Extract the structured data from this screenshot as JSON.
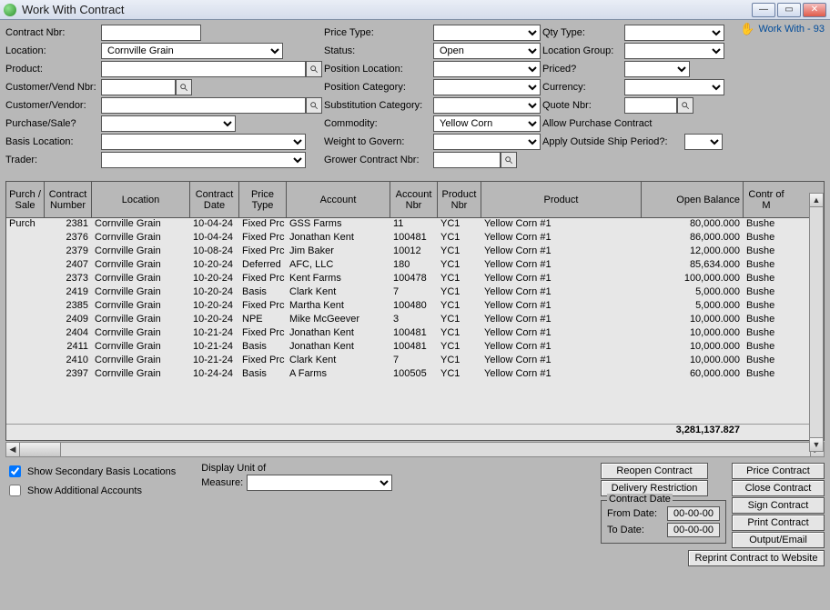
{
  "window": {
    "title": "Work With Contract"
  },
  "status": {
    "text": "Work With  - 93"
  },
  "form": {
    "col1": {
      "contract_nbr": {
        "label": "Contract Nbr:"
      },
      "location": {
        "label": "Location:",
        "value": "Cornville Grain"
      },
      "product": {
        "label": "Product:"
      },
      "cust_vend_nbr": {
        "label": "Customer/Vend Nbr:"
      },
      "cust_vendor": {
        "label": "Customer/Vendor:"
      },
      "purchase_sale": {
        "label": "Purchase/Sale?"
      },
      "basis_location": {
        "label": "Basis Location:"
      },
      "trader": {
        "label": "Trader:"
      }
    },
    "col2": {
      "price_type": {
        "label": "Price Type:"
      },
      "status": {
        "label": "Status:",
        "value": "Open"
      },
      "position_location": {
        "label": "Position Location:"
      },
      "position_category": {
        "label": "Position Category:"
      },
      "substitution_category": {
        "label": "Substitution Category:"
      },
      "commodity": {
        "label": "Commodity:",
        "value": "Yellow Corn"
      },
      "weight_govern": {
        "label": "Weight to Govern:"
      },
      "grower_contract_nbr": {
        "label": "Grower Contract Nbr:"
      }
    },
    "col3": {
      "qty_type": {
        "label": "Qty Type:"
      },
      "location_group": {
        "label": "Location Group:"
      },
      "priced": {
        "label": "Priced?"
      },
      "currency": {
        "label": "Currency:"
      },
      "quote_nbr": {
        "label": "Quote Nbr:"
      },
      "allow_purchase": {
        "label": "Allow Purchase Contract"
      },
      "apply_outside": {
        "label": "Apply Outside Ship Period?:"
      }
    }
  },
  "grid": {
    "headers": {
      "purch_sale": "Purch / Sale",
      "contract_number": "Contract Number",
      "location": "Location",
      "contract_date": "Contract Date",
      "price_type": "Price Type",
      "account": "Account",
      "account_nbr": "Account Nbr",
      "product_nbr": "Product Nbr",
      "product": "Product",
      "open_balance": "Open Balance",
      "unit_measure": "Contr of M"
    },
    "rows": [
      {
        "ps": "Purch",
        "cn": "2381",
        "loc": "Cornville Grain",
        "cd": "10-04-24",
        "pt": "Fixed Prc",
        "acc": "GSS Farms",
        "an": "11",
        "pn": "YC1",
        "prod": "Yellow Corn #1",
        "ob": "80,000.000",
        "um": "Bushe"
      },
      {
        "ps": "",
        "cn": "2376",
        "loc": "Cornville Grain",
        "cd": "10-04-24",
        "pt": "Fixed Prc",
        "acc": "Jonathan Kent",
        "an": "100481",
        "pn": "YC1",
        "prod": "Yellow Corn #1",
        "ob": "86,000.000",
        "um": "Bushe"
      },
      {
        "ps": "",
        "cn": "2379",
        "loc": "Cornville Grain",
        "cd": "10-08-24",
        "pt": "Fixed Prc",
        "acc": "Jim Baker",
        "an": "10012",
        "pn": "YC1",
        "prod": "Yellow Corn #1",
        "ob": "12,000.000",
        "um": "Bushe"
      },
      {
        "ps": "",
        "cn": "2407",
        "loc": "Cornville Grain",
        "cd": "10-20-24",
        "pt": "Deferred",
        "acc": "AFC, LLC",
        "an": "180",
        "pn": "YC1",
        "prod": "Yellow Corn #1",
        "ob": "85,634.000",
        "um": "Bushe"
      },
      {
        "ps": "",
        "cn": "2373",
        "loc": "Cornville Grain",
        "cd": "10-20-24",
        "pt": "Fixed Prc",
        "acc": "Kent Farms",
        "an": "100478",
        "pn": "YC1",
        "prod": "Yellow Corn #1",
        "ob": "100,000.000",
        "um": "Bushe"
      },
      {
        "ps": "",
        "cn": "2419",
        "loc": "Cornville Grain",
        "cd": "10-20-24",
        "pt": "Basis",
        "acc": "Clark Kent",
        "an": "7",
        "pn": "YC1",
        "prod": "Yellow Corn #1",
        "ob": "5,000.000",
        "um": "Bushe"
      },
      {
        "ps": "",
        "cn": "2385",
        "loc": "Cornville Grain",
        "cd": "10-20-24",
        "pt": "Fixed Prc",
        "acc": "Martha Kent",
        "an": "100480",
        "pn": "YC1",
        "prod": "Yellow Corn #1",
        "ob": "5,000.000",
        "um": "Bushe"
      },
      {
        "ps": "",
        "cn": "2409",
        "loc": "Cornville Grain",
        "cd": "10-20-24",
        "pt": "NPE",
        "acc": "Mike McGeever",
        "an": "3",
        "pn": "YC1",
        "prod": "Yellow Corn #1",
        "ob": "10,000.000",
        "um": "Bushe"
      },
      {
        "ps": "",
        "cn": "2404",
        "loc": "Cornville Grain",
        "cd": "10-21-24",
        "pt": "Fixed Prc",
        "acc": "Jonathan Kent",
        "an": "100481",
        "pn": "YC1",
        "prod": "Yellow Corn #1",
        "ob": "10,000.000",
        "um": "Bushe"
      },
      {
        "ps": "",
        "cn": "2411",
        "loc": "Cornville Grain",
        "cd": "10-21-24",
        "pt": "Basis",
        "acc": "Jonathan Kent",
        "an": "100481",
        "pn": "YC1",
        "prod": "Yellow Corn #1",
        "ob": "10,000.000",
        "um": "Bushe"
      },
      {
        "ps": "",
        "cn": "2410",
        "loc": "Cornville Grain",
        "cd": "10-21-24",
        "pt": "Fixed Prc",
        "acc": "Clark Kent",
        "an": "7",
        "pn": "YC1",
        "prod": "Yellow Corn #1",
        "ob": "10,000.000",
        "um": "Bushe"
      },
      {
        "ps": "",
        "cn": "2397",
        "loc": "Cornville Grain",
        "cd": "10-24-24",
        "pt": "Basis",
        "acc": "A Farms",
        "an": "100505",
        "pn": "YC1",
        "prod": "Yellow Corn #1",
        "ob": "60,000.000",
        "um": "Bushe"
      }
    ],
    "totals": {
      "open_balance": "3,281,137.827"
    }
  },
  "bottom": {
    "show_secondary": "Show Secondary Basis Locations",
    "show_additional": "Show Additional Accounts",
    "display_unit": {
      "label1": "Display Unit of",
      "label2": "Measure:"
    },
    "contract_date": {
      "legend": "Contract Date",
      "from_label": "From Date:",
      "from_value": "00-00-00",
      "to_label": "To Date:",
      "to_value": "00-00-00"
    },
    "buttons1": {
      "reopen": "Reopen Contract",
      "delivery": "Delivery Restriction"
    },
    "buttons2": {
      "price": "Price Contract",
      "close": "Close Contract",
      "sign": "Sign Contract",
      "print": "Print Contract",
      "output": "Output/Email"
    },
    "reprint": "Reprint Contract to Website"
  }
}
